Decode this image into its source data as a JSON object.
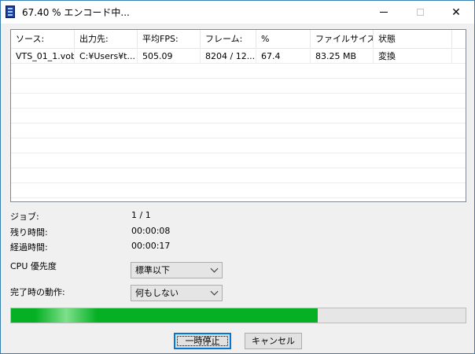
{
  "window": {
    "title": "67.40 % エンコード中..."
  },
  "list": {
    "columns": [
      "ソース:",
      "出力先:",
      "平均FPS:",
      "フレーム:",
      "%",
      "ファイルサイズ:",
      "状態"
    ],
    "rows": [
      [
        "VTS_01_1.vob",
        "C:¥Users¥t...",
        "505.09",
        "8204 / 12...",
        "67.4",
        "83.25 MB",
        "変換"
      ]
    ]
  },
  "info": {
    "job_label": "ジョブ:",
    "job_value": "1 / 1",
    "remaining_label": "残り時間:",
    "remaining_value": "00:00:08",
    "elapsed_label": "経過時間:",
    "elapsed_value": "00:00:17",
    "cpu_label": "CPU 優先度",
    "cpu_value": "標準以下",
    "finish_label": "完了時の動作:",
    "finish_value": "何もしない"
  },
  "progress": {
    "percent": 67.4,
    "color": "#06b025"
  },
  "buttons": {
    "pause": "一時停止",
    "cancel": "キャンセル"
  },
  "icons": {
    "app": "film-icon",
    "minimize": "minimize-icon",
    "maximize": "maximize-icon",
    "close": "close-icon"
  }
}
